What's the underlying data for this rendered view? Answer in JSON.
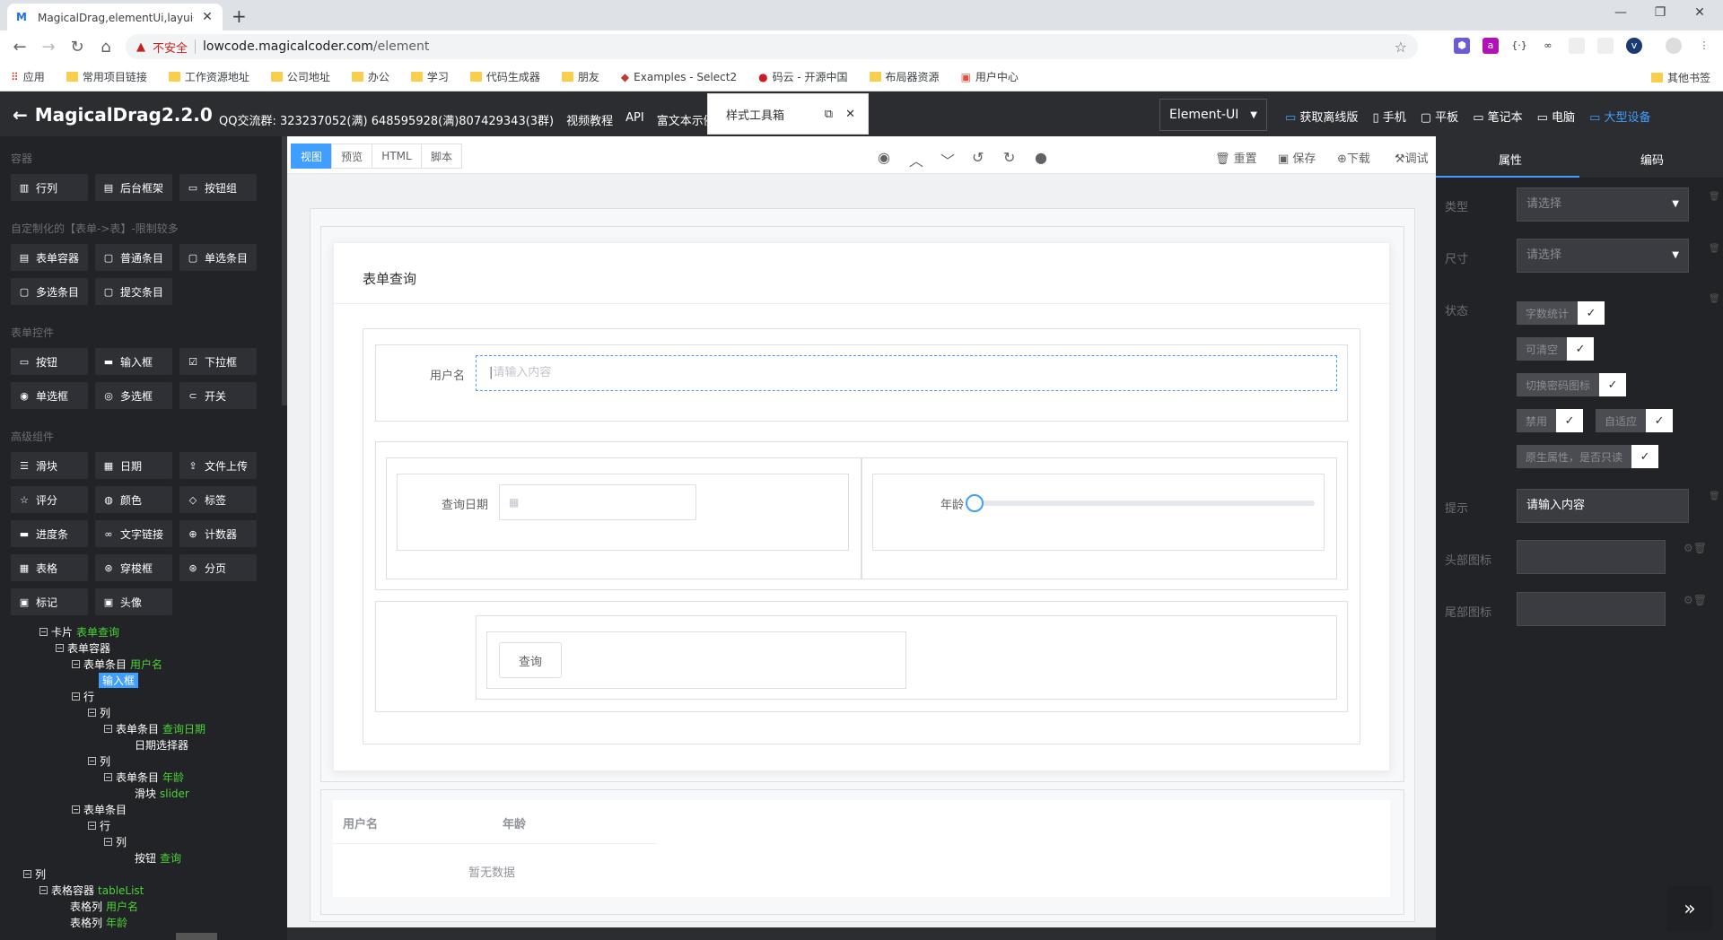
{
  "browser": {
    "tab_title": "MagicalDrag,elementUi,layui开",
    "new_tab": "+",
    "url_warning": "不安全",
    "url_host": "lowcode.magicalcoder.com",
    "url_path": "/element",
    "bookmarks": [
      "应用",
      "常用项目链接",
      "工作资源地址",
      "公司地址",
      "办公",
      "学习",
      "代码生成器",
      "朋友",
      "Examples - Select2",
      "码云 - 开源中国",
      "布局器资源",
      "用户中心"
    ],
    "bookmark_other": "其他书签"
  },
  "header": {
    "brand": "MagicalDrag2.2.0",
    "qq": "QQ交流群: 323237052(满) 648595928(满)807429343(3群)",
    "links": [
      "视频教程",
      "API",
      "富文本示例"
    ],
    "style_toolbox": "样式工具箱",
    "ui_framework": "Element-UI",
    "offline": "获取离线版",
    "devices": [
      "手机",
      "平板",
      "笔记本",
      "电脑",
      "大型设备"
    ]
  },
  "left": {
    "sections": [
      "容器",
      "自定制化的【表单->表】-限制较多",
      "表单控件",
      "高级组件"
    ],
    "container": [
      "行列",
      "后台框架",
      "按钮组"
    ],
    "custom": [
      "表单容器",
      "普通条目",
      "单选条目",
      "多选条目",
      "提交条目"
    ],
    "form": [
      "按钮",
      "输入框",
      "下拉框",
      "单选框",
      "多选框",
      "开关"
    ],
    "advanced": [
      "滑块",
      "日期",
      "文件上传",
      "评分",
      "颜色",
      "标签",
      "进度条",
      "文字链接",
      "计数器",
      "表格",
      "穿梭框",
      "分页",
      "标记",
      "头像"
    ],
    "tree": [
      {
        "t": "卡片",
        "g": "表单查询"
      },
      {
        "t": "表单容器",
        "g": ""
      },
      {
        "t": "表单条目",
        "g": "用户名"
      },
      {
        "t": "输入框",
        "g": ""
      },
      {
        "t": "行",
        "g": ""
      },
      {
        "t": "列",
        "g": ""
      },
      {
        "t": "表单条目",
        "g": "查询日期"
      },
      {
        "t": "日期选择器",
        "g": ""
      },
      {
        "t": "列",
        "g": ""
      },
      {
        "t": "表单条目",
        "g": "年龄"
      },
      {
        "t": "滑块",
        "g": "slider"
      },
      {
        "t": "表单条目",
        "g": ""
      },
      {
        "t": "行",
        "g": ""
      },
      {
        "t": "列",
        "g": ""
      },
      {
        "t": "按钮",
        "g": "查询"
      },
      {
        "t": "列",
        "g": ""
      },
      {
        "t": "表格容器",
        "g": "tableList"
      },
      {
        "t": "表格列",
        "g": "用户名"
      },
      {
        "t": "表格列",
        "g": "年龄"
      }
    ]
  },
  "canvas": {
    "tabs": [
      "视图",
      "预览",
      "HTML",
      "脚本"
    ],
    "actions": [
      "重置",
      "保存",
      "下载",
      "调试"
    ],
    "card_title": "表单查询",
    "username_label": "用户名",
    "username_placeholder": "请输入内容",
    "date_label": "查询日期",
    "age_label": "年龄",
    "age_value": 0,
    "query_button": "查询",
    "table_headers": [
      "用户名",
      "年龄"
    ],
    "table_empty": "暂无数据"
  },
  "right": {
    "tabs": [
      "属性",
      "编码"
    ],
    "type_label": "类型",
    "size_label": "尺寸",
    "status_label": "状态",
    "select_placeholder": "请选择",
    "chips": [
      "字数统计",
      "可清空",
      "切换密码图标",
      "禁用",
      "自适应",
      "原生属性，是否只读"
    ],
    "hint_label": "提示",
    "hint_value": "请输入内容",
    "head_icon_label": "头部图标",
    "tail_icon_label": "尾部图标"
  },
  "colors": {
    "accent": "#409eff",
    "dark": "#222326",
    "green": "#4cd137"
  }
}
